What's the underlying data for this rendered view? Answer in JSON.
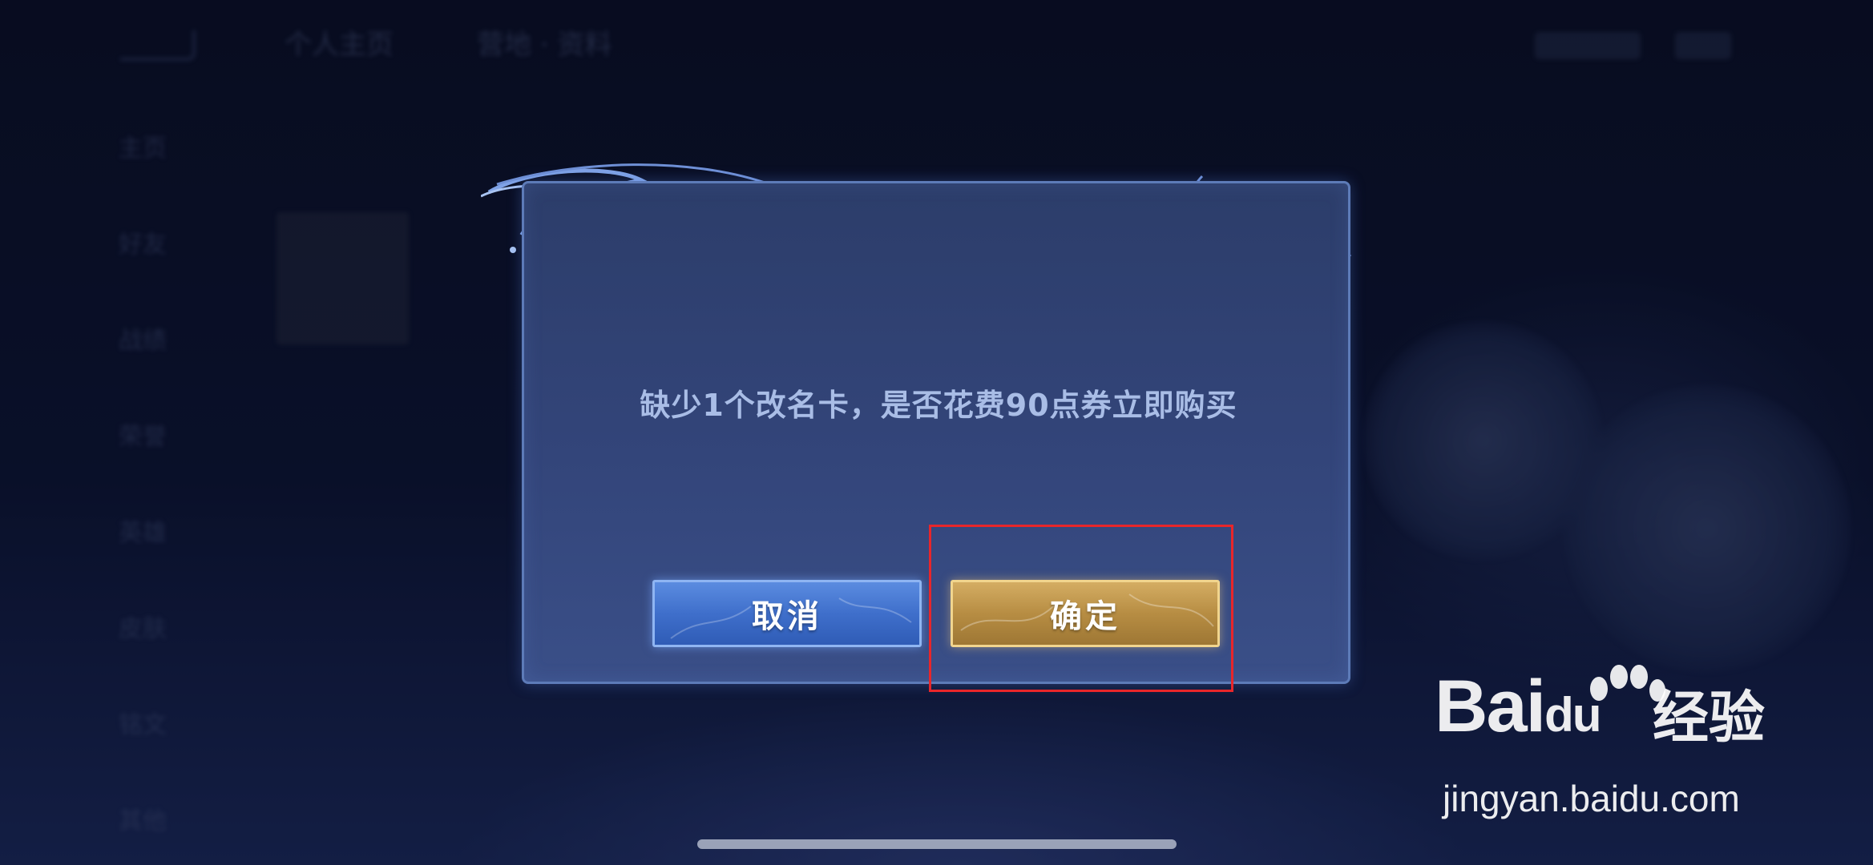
{
  "background": {
    "top_tabs": [
      "个人主页",
      "营地 · 资料"
    ],
    "side_items": [
      "主页",
      "好友",
      "战绩",
      "荣誉",
      "英雄",
      "皮肤",
      "铭文",
      "其他"
    ]
  },
  "dialog": {
    "message": "缺少1个改名卡，是否花费90点券立即购买",
    "cancel_label": "取消",
    "confirm_label": "确定"
  },
  "watermark": {
    "brand": "Bai",
    "brand_du": "du",
    "brand_cn": "经验",
    "url": "jingyan.baidu.com"
  },
  "colors": {
    "cancel_button": "#3f6fcb",
    "confirm_button": "#b78d43",
    "highlight": "#e8262a",
    "message_text": "#a9bde6"
  }
}
